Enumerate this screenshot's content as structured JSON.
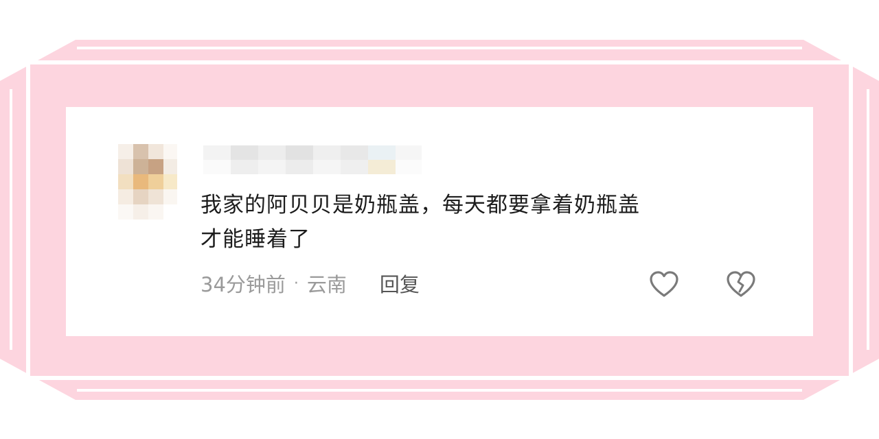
{
  "comment": {
    "text": "我家的阿贝贝是奶瓶盖，每天都要拿着奶瓶盖才能睡着了",
    "line1": "我家的阿贝贝是奶瓶盖，每天都要拿着奶瓶盖",
    "line2": "才能睡着了",
    "time": "34分钟前",
    "separator": "·",
    "location": "云南",
    "reply_label": "回复"
  },
  "icons": {
    "like": "heart-icon",
    "dislike": "broken-heart-icon"
  },
  "colors": {
    "frame_pink": "#fdd5df",
    "text_primary": "#1c1c1c",
    "text_secondary": "#9a9a9a"
  }
}
